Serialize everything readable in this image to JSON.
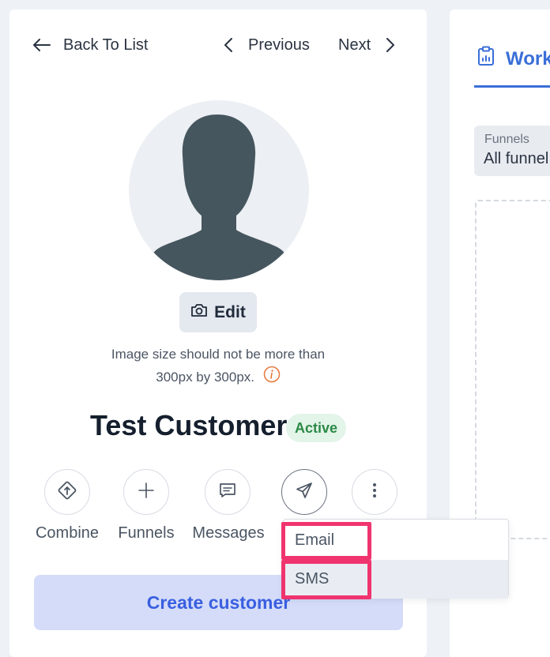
{
  "nav": {
    "back_label": "Back To List",
    "previous_label": "Previous",
    "next_label": "Next"
  },
  "profile": {
    "edit_label": "Edit",
    "image_hint_line1": "Image size should not be more than",
    "image_hint_line2": "300px by 300px.",
    "name": "Test Customer",
    "status": "Active"
  },
  "actions": [
    {
      "label": "Combine",
      "icon": "combine-icon"
    },
    {
      "label": "Funnels",
      "icon": "plus-icon"
    },
    {
      "label": "Messages",
      "icon": "message-icon"
    },
    {
      "label": "",
      "icon": "send-icon"
    },
    {
      "label": "",
      "icon": "more-vertical-icon"
    }
  ],
  "send_menu": {
    "items": [
      "Email",
      "SMS"
    ],
    "hovered": "SMS"
  },
  "create_button_label": "Create customer",
  "right_panel": {
    "tab_label": "Work",
    "funnels_label": "Funnels",
    "funnels_value": "All funnel"
  },
  "colors": {
    "accent": "#3a6fd8",
    "status_bg": "#e3f4e8",
    "status_text": "#2a8a46",
    "highlight": "#f0346f",
    "create_bg": "#d4dcf9"
  }
}
